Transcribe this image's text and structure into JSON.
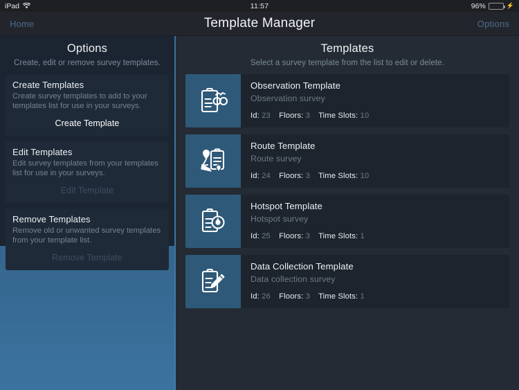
{
  "status_bar": {
    "device": "iPad",
    "wifi_icon": "wifi-icon",
    "time": "11:57",
    "battery_percent": "96%",
    "battery_icon": "battery-icon",
    "charging_icon": "charging-bolt-icon"
  },
  "nav_bar": {
    "back_label": "Home",
    "title": "Template Manager",
    "right_label": "Options"
  },
  "options_panel": {
    "title": "Options",
    "subtitle": "Create, edit or remove survey templates.",
    "cards": [
      {
        "title": "Create Templates",
        "description": "Create survey templates to add to your templates list for use in your surveys.",
        "button_label": "Create Template",
        "enabled": true
      },
      {
        "title": "Edit Templates",
        "description": "Edit survey templates from your templates list for use in your surveys.",
        "button_label": "Edit Template",
        "enabled": false
      },
      {
        "title": "Remove Templates",
        "description": "Remove old or unwanted survey templates from your template list.",
        "button_label": "Remove Template",
        "enabled": false
      }
    ]
  },
  "templates_panel": {
    "title": "Templates",
    "subtitle": "Select a survey template from the list to edit or delete.",
    "labels": {
      "id": "Id:",
      "floors": "Floors:",
      "time_slots": "Time Slots:"
    },
    "rows": [
      {
        "title": "Observation Template",
        "subtitle": "Observation survey",
        "id": "23",
        "floors": "3",
        "time_slots": "10",
        "icon": "clipboard-binoculars-icon"
      },
      {
        "title": "Route Template",
        "subtitle": "Route survey",
        "id": "24",
        "floors": "3",
        "time_slots": "10",
        "icon": "clipboard-route-pin-icon"
      },
      {
        "title": "Hotspot Template",
        "subtitle": "Hotspot survey",
        "id": "25",
        "floors": "3",
        "time_slots": "1",
        "icon": "clipboard-flame-icon"
      },
      {
        "title": "Data Collection Template",
        "subtitle": "Data collection survey",
        "id": "26",
        "floors": "3",
        "time_slots": "1",
        "icon": "clipboard-pencil-icon"
      }
    ]
  },
  "colors": {
    "status_bar_bg": "#1e1f23",
    "nav_bar_bg": "#22262c",
    "sidebar_bg": "#1b2531",
    "card_bg": "#1e2a38",
    "content_bg": "#242b34",
    "row_bg": "#1d242e",
    "icon_tile": "#2f5978",
    "accent_link": "#4e6b8c",
    "page_gradient_top": "#2f5677",
    "page_gradient_bottom": "#3b73a0",
    "battery_green": "#4cd764",
    "muted_text": "#6e7a86"
  }
}
